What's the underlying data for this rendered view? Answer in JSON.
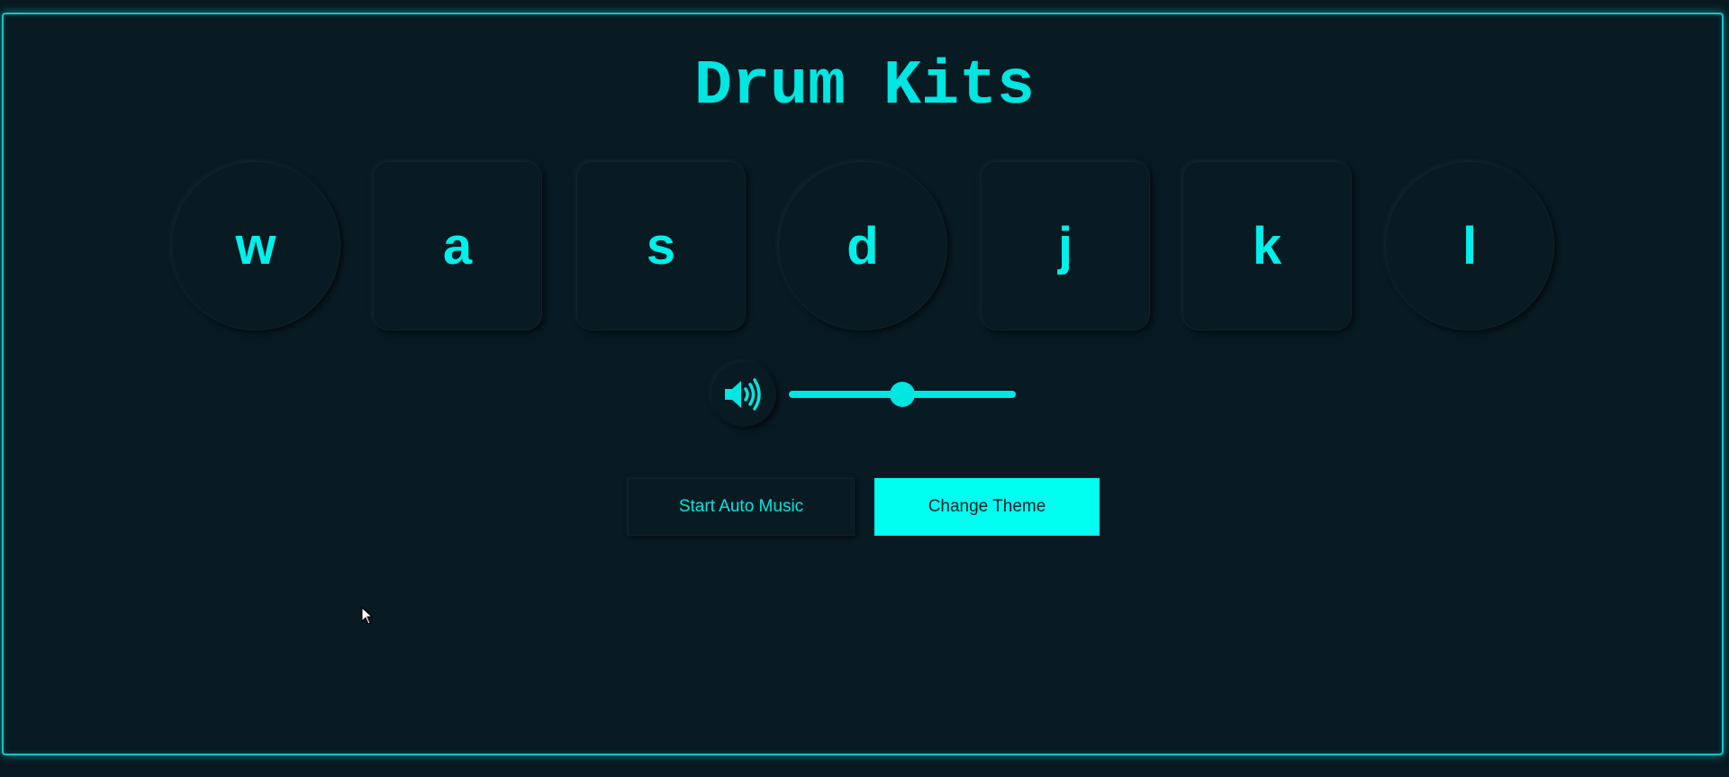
{
  "app": {
    "title": "Drum Kits"
  },
  "pads": [
    {
      "key": "w",
      "shape": "round"
    },
    {
      "key": "a",
      "shape": "square"
    },
    {
      "key": "s",
      "shape": "square"
    },
    {
      "key": "d",
      "shape": "round"
    },
    {
      "key": "j",
      "shape": "square"
    },
    {
      "key": "k",
      "shape": "square"
    },
    {
      "key": "l",
      "shape": "round"
    }
  ],
  "volume": {
    "icon": "speaker-volume-icon",
    "level_percent": 50
  },
  "controls": {
    "auto_music_label": "Start Auto Music",
    "change_theme_label": "Change Theme"
  },
  "colors": {
    "background": "#081a22",
    "accent": "#00e6e0",
    "accent_bright": "#00fff0",
    "border_glow": "#13c4c4"
  }
}
